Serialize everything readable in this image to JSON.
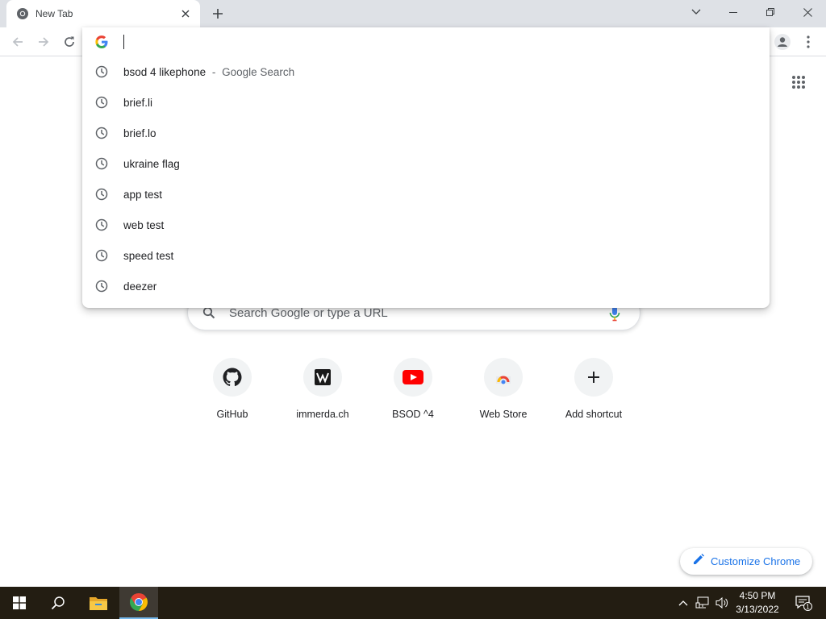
{
  "browser": {
    "tab": {
      "title": "New Tab",
      "icon": "chrome-icon"
    },
    "window_controls": [
      "tab-search-icon",
      "minimize-icon",
      "restore-icon",
      "close-icon"
    ]
  },
  "omnibox": {
    "value": "",
    "suggestions": [
      {
        "text": "bsod 4 likephone",
        "separator": "-",
        "description": "Google Search",
        "icon": "history-clock-icon"
      },
      {
        "text": "brief.li",
        "icon": "history-clock-icon"
      },
      {
        "text": "brief.lo",
        "icon": "history-clock-icon"
      },
      {
        "text": "ukraine flag",
        "icon": "history-clock-icon"
      },
      {
        "text": "app test",
        "icon": "history-clock-icon"
      },
      {
        "text": "web test",
        "icon": "history-clock-icon"
      },
      {
        "text": "speed test",
        "icon": "history-clock-icon"
      },
      {
        "text": "deezer",
        "icon": "history-clock-icon"
      }
    ]
  },
  "ntp": {
    "search_placeholder": "Search Google or type a URL",
    "shortcuts": [
      {
        "label": "GitHub",
        "icon": "github-icon"
      },
      {
        "label": "immerda.ch",
        "icon": "immerda-icon"
      },
      {
        "label": "BSOD ^4",
        "icon": "youtube-icon"
      },
      {
        "label": "Web Store",
        "icon": "web-store-icon"
      },
      {
        "label": "Add shortcut",
        "icon": "plus-icon"
      }
    ],
    "customize_label": "Customize Chrome"
  },
  "taskbar": {
    "time": "4:50 PM",
    "date": "3/13/2022",
    "notification_count": "1"
  },
  "colors": {
    "accent": "#1a73e8",
    "taskbar": "#231d12",
    "tabstrip": "#dee1e6"
  }
}
